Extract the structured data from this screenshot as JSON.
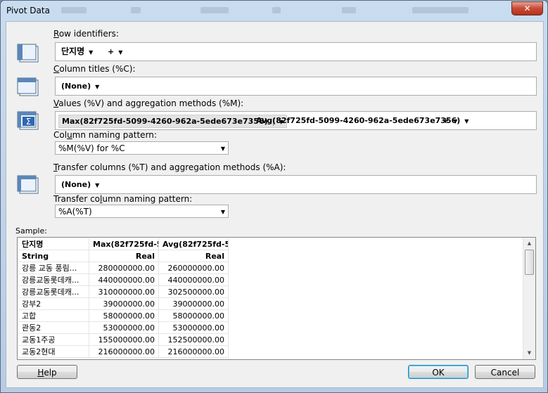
{
  "window": {
    "title": "Pivot Data",
    "close_glyph": "✕"
  },
  "row_identifiers": {
    "label_key": "R",
    "label_rest": "ow identifiers:",
    "chips": [
      "단지명"
    ],
    "add": "+"
  },
  "column_titles": {
    "label_key": "C",
    "label_rest": "olumn titles (%C):",
    "chips": [
      "(None)"
    ]
  },
  "values": {
    "label_key": "V",
    "label_rest": "alues (%V) and aggregation methods (%M):",
    "chips": [
      "Max(82f725fd-5099-4260-962a-5ede673e7356)",
      "Avg(82f725fd-5099-4260-962a-5ede673e7356)"
    ],
    "add": "+"
  },
  "column_naming": {
    "label_pre": "Col",
    "label_key": "u",
    "label_rest": "mn naming pattern:",
    "value": "%M(%V) for %C"
  },
  "transfer_columns": {
    "label_key": "T",
    "label_rest": "ransfer columns (%T) and aggregation methods (%A):",
    "chips": [
      "(None)"
    ]
  },
  "transfer_naming": {
    "label_pre": "Transfer co",
    "label_key": "l",
    "label_rest": "umn naming pattern:",
    "value": "%A(%T)"
  },
  "sample": {
    "label": "Sample:",
    "headers": [
      "단지명",
      "Max(82f725fd-5...",
      "Avg(82f725fd-5..."
    ],
    "types": [
      "String",
      "Real",
      "Real"
    ],
    "rows": [
      [
        "강릉 교동 풍림...",
        "280000000.00",
        "260000000.00"
      ],
      [
        "강릉교동롯데캐...",
        "440000000.00",
        "440000000.00"
      ],
      [
        "강릉교동롯데캐...",
        "310000000.00",
        "302500000.00"
      ],
      [
        "강부2",
        "39000000.00",
        "39000000.00"
      ],
      [
        "고합",
        "58000000.00",
        "58000000.00"
      ],
      [
        "관동2",
        "53000000.00",
        "53000000.00"
      ],
      [
        "교동1주공",
        "155000000.00",
        "152500000.00"
      ],
      [
        "교동2현대",
        "216000000.00",
        "216000000.00"
      ]
    ]
  },
  "buttons": {
    "help_key": "H",
    "help_rest": "elp",
    "ok": "OK",
    "cancel": "Cancel"
  }
}
